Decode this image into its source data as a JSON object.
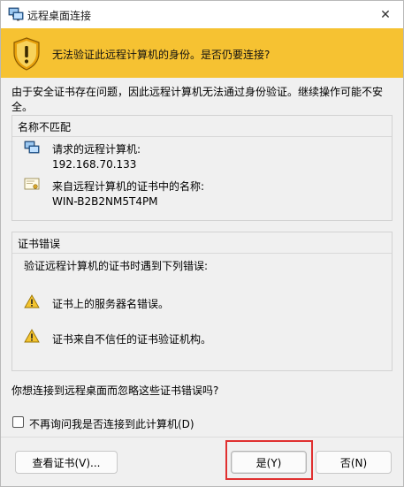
{
  "window": {
    "title": "远程桌面连接",
    "icon": "remote-desktop-icon",
    "close_glyph": "✕"
  },
  "banner": {
    "icon": "shield-warning-icon",
    "text": "无法验证此远程计算机的身份。是否仍要连接?",
    "color": "#f6c232"
  },
  "intro_text": "由于安全证书存在问题，因此远程计算机无法通过身份验证。继续操作可能不安全。",
  "name_mismatch": {
    "title": "名称不匹配",
    "requested_label": "请求的远程计算机:",
    "requested_value": "192.168.70.133",
    "cert_name_label": "来自远程计算机的证书中的名称:",
    "cert_name_value": "WIN-B2B2NM5T4PM"
  },
  "cert_errors": {
    "title": "证书错误",
    "description": "验证远程计算机的证书时遇到下列错误:",
    "errors": [
      "证书上的服务器名错误。",
      "证书来自不信任的证书验证机构。"
    ]
  },
  "question": "你想连接到远程桌面而忽略这些证书错误吗?",
  "dont_ask_checkbox": {
    "label": "不再询问我是否连接到此计算机(D)",
    "checked": false
  },
  "buttons": {
    "view_cert": "查看证书(V)...",
    "yes": "是(Y)",
    "no": "否(N)"
  },
  "highlight_color": "#e03030"
}
